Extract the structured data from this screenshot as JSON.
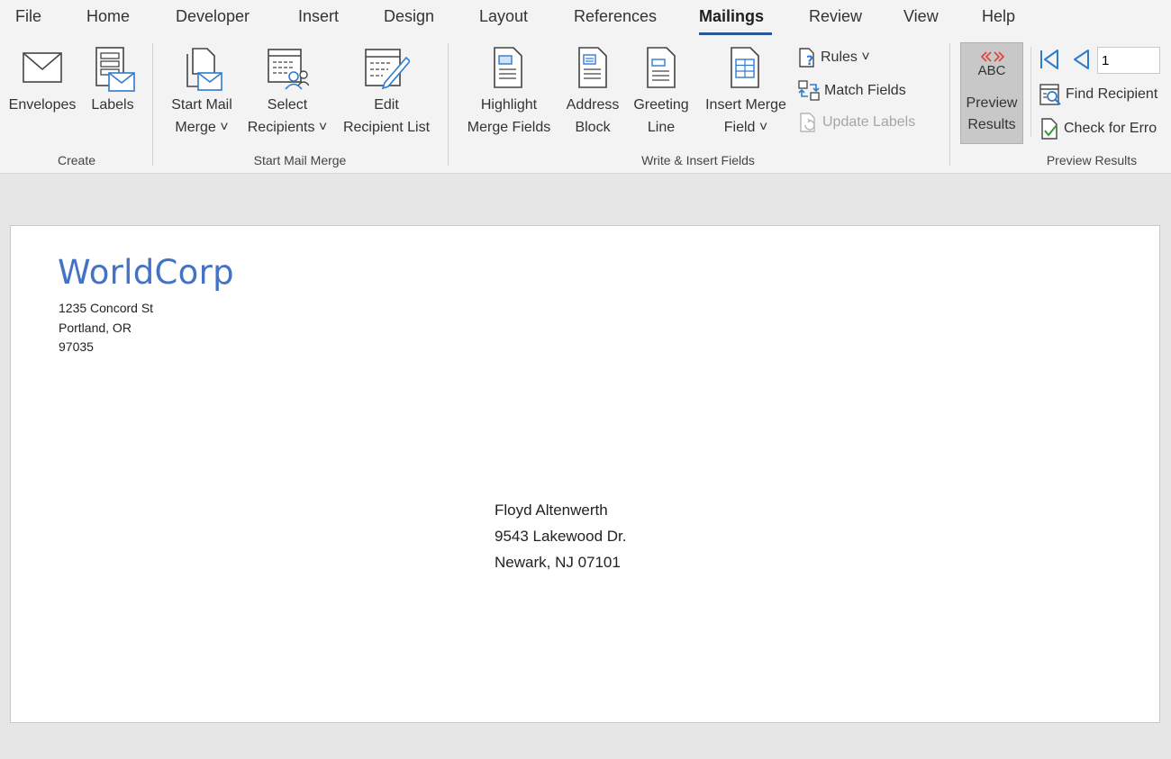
{
  "menu": {
    "tabs": [
      "File",
      "Home",
      "Developer",
      "Insert",
      "Design",
      "Layout",
      "References",
      "Mailings",
      "Review",
      "View",
      "Help"
    ],
    "active_tab": "Mailings"
  },
  "ribbon": {
    "create": {
      "label": "Create",
      "envelopes": "Envelopes",
      "labels": "Labels"
    },
    "start_mail_merge": {
      "label": "Start Mail Merge",
      "start_mail_merge": [
        "Start Mail",
        "Merge ˅"
      ],
      "select_recipients": [
        "Select",
        "Recipients ˅"
      ],
      "edit_recipient_list": [
        "Edit",
        "Recipient List"
      ]
    },
    "write_insert": {
      "label": "Write & Insert Fields",
      "highlight": [
        "Highlight",
        "Merge Fields"
      ],
      "address_block": [
        "Address",
        "Block"
      ],
      "greeting_line": [
        "Greeting",
        "Line"
      ],
      "insert_merge_field": [
        "Insert Merge",
        "Field ˅"
      ],
      "rules": "Rules ˅",
      "match_fields": "Match Fields",
      "update_labels": "Update Labels"
    },
    "preview": {
      "label": "Preview Results",
      "preview_results": [
        "Preview",
        "Results"
      ],
      "abc": "ABC",
      "record_number": "1",
      "find_recipient": "Find Recipient",
      "check_errors": "Check for Erro"
    }
  },
  "colors": {
    "accent": "#2b579a",
    "company_blue": "#4472c4",
    "preview_red": "#e0403a",
    "icon_blue": "#2e7bcf"
  },
  "document": {
    "return_address": {
      "company": "WorldCorp",
      "street": "1235 Concord St",
      "city_state": "Portland, OR",
      "zip": "97035"
    },
    "recipient": {
      "name": "Floyd Altenwerth",
      "street": "9543 Lakewood Dr.",
      "city_line": "Newark, NJ  07101"
    }
  }
}
